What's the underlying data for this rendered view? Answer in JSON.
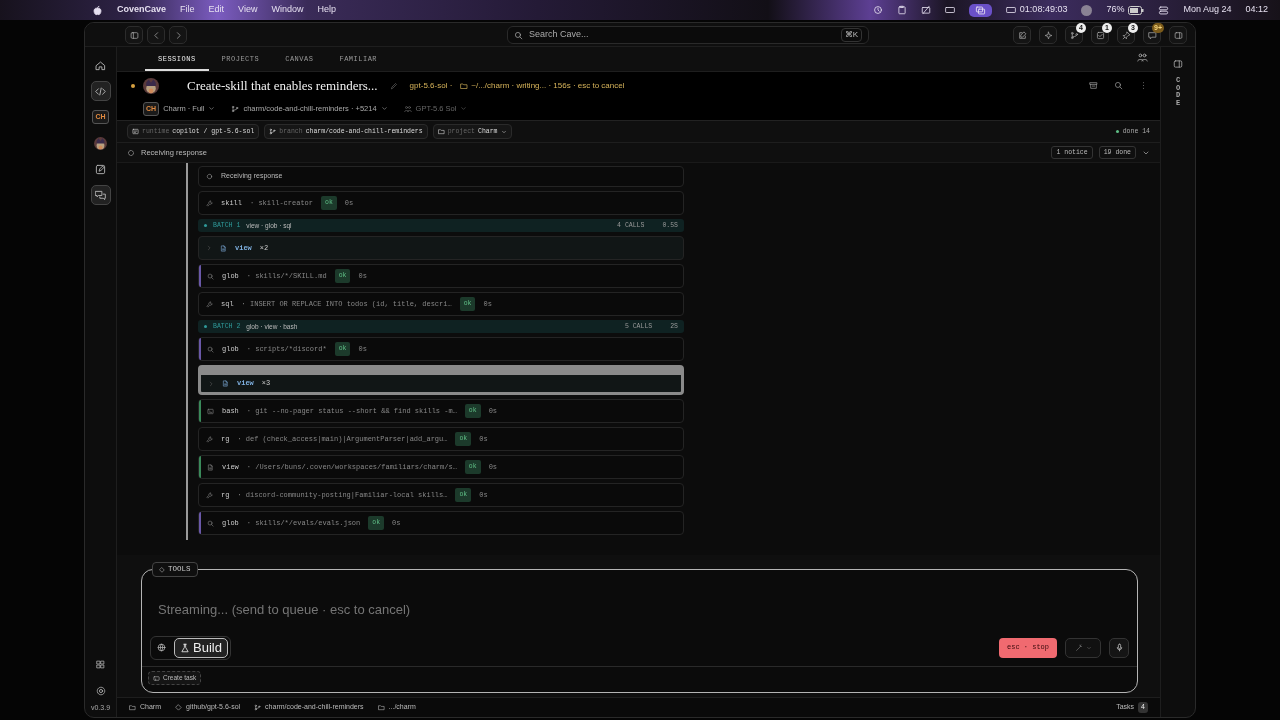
{
  "menubar": {
    "app": "CovenCave",
    "menus": [
      "File",
      "Edit",
      "View",
      "Window",
      "Help"
    ],
    "timer": "01:08:49:03",
    "battery": "76%",
    "date": "Mon Aug 24",
    "time": "04:12"
  },
  "titlebar": {
    "search_placeholder": "Search Cave...",
    "shortcut": "⌘K",
    "badges": [
      "4",
      "1",
      "3",
      "9+"
    ]
  },
  "rail": [
    {
      "kind": "icon",
      "selected": false
    },
    {
      "kind": "icon",
      "selected": true
    },
    {
      "kind": "tile",
      "label": "CH",
      "selected": false
    },
    {
      "kind": "picture",
      "selected": false
    },
    {
      "kind": "icon",
      "selected": false
    },
    {
      "kind": "icon",
      "selected": true
    }
  ],
  "rail_bottom": {
    "version": "v0.3.9"
  },
  "tabs": [
    {
      "label": "SESSIONS",
      "selected": true
    },
    {
      "label": "PROJECTS",
      "selected": false
    },
    {
      "label": "CANVAS",
      "selected": false
    },
    {
      "label": "FAMILIAR",
      "selected": false
    }
  ],
  "session": {
    "title": "Create-skill that enables reminders...",
    "model": "gpt-5.6-sol ·",
    "meta": "~/.../charm · writing... · 156s · esc to cancel",
    "agent_tag": "CH",
    "agent": "Charm · Full",
    "branch": "charm/code-and-chill-reminders · +5214",
    "model_pick": "GPT-5.6 Sol"
  },
  "chips": [
    {
      "label": "runtime",
      "value": "copilot / gpt-5.6-sol"
    },
    {
      "label": "branch",
      "value": "charm/code-and-chill-reminders"
    },
    {
      "label": "project",
      "value": "Charm"
    }
  ],
  "done_count": "done 14",
  "status": {
    "text": "Receiving response",
    "badges": [
      "1 notice",
      "19 done"
    ]
  },
  "tools": [
    {
      "kind": "status",
      "text": "Receiving response"
    },
    {
      "kind": "action",
      "tool": "skill",
      "arg": "· skill-creator",
      "result": "ok",
      "time": "0s"
    },
    {
      "kind": "batch",
      "label": "BATCH 1",
      "tools": "view · glob · sql",
      "calls": "4 CALLS",
      "time": "0.5S"
    },
    {
      "kind": "group",
      "tool": "view",
      "count": "×2",
      "expanded": false,
      "selected": false
    },
    {
      "kind": "search",
      "tool": "glob",
      "arg": "· skills/*/SKILL.md",
      "result": "ok",
      "time": "0s",
      "color": "#6a58a8"
    },
    {
      "kind": "action",
      "tool": "sql",
      "arg": "· INSERT OR REPLACE INTO todos (id, title, descri…",
      "result": "ok",
      "time": "0s"
    },
    {
      "kind": "batch",
      "label": "BATCH 2",
      "tools": "glob · view · bash",
      "calls": "5 CALLS",
      "time": "2S"
    },
    {
      "kind": "search",
      "tool": "glob",
      "arg": "· scripts/*discord*",
      "result": "ok",
      "time": "0s",
      "color": "#6a58a8"
    },
    {
      "kind": "group",
      "tool": "view",
      "count": "×3",
      "expanded": false,
      "selected": true
    },
    {
      "kind": "shell",
      "tool": "bash",
      "arg": "· git --no-pager status --short && find skills -m…",
      "result": "ok",
      "time": "0s",
      "color": "#3a8a5a"
    },
    {
      "kind": "action",
      "tool": "rg",
      "arg": "· def (check_access|main)|ArgumentParser|add_argu…",
      "result": "ok",
      "time": "0s"
    },
    {
      "kind": "read",
      "tool": "view",
      "arg": "· /Users/buns/.coven/workspaces/familiars/charm/s…",
      "result": "ok",
      "time": "0s",
      "color": "#3a8a5a"
    },
    {
      "kind": "action",
      "tool": "rg",
      "arg": "· discord-community-posting|Familiar-local skills…",
      "result": "ok",
      "time": "0s"
    },
    {
      "kind": "search",
      "tool": "glob",
      "arg": "· skills/*/evals/evals.json",
      "result": "ok",
      "time": "0s",
      "color": "#6a58a8"
    }
  ],
  "composer": {
    "tag": "TOOLS",
    "placeholder": "Streaming... (send to queue · esc to cancel)",
    "mode": "Build",
    "stop": "esc · stop",
    "create_task": "Create task"
  },
  "footer": {
    "items": [
      "Charm",
      "github/gpt-5.6-sol",
      "charm/code-and-chill-reminders",
      ".../charm"
    ],
    "tasks": "Tasks",
    "tasks_count": "4"
  },
  "right_rail": {
    "label": "CODE"
  }
}
